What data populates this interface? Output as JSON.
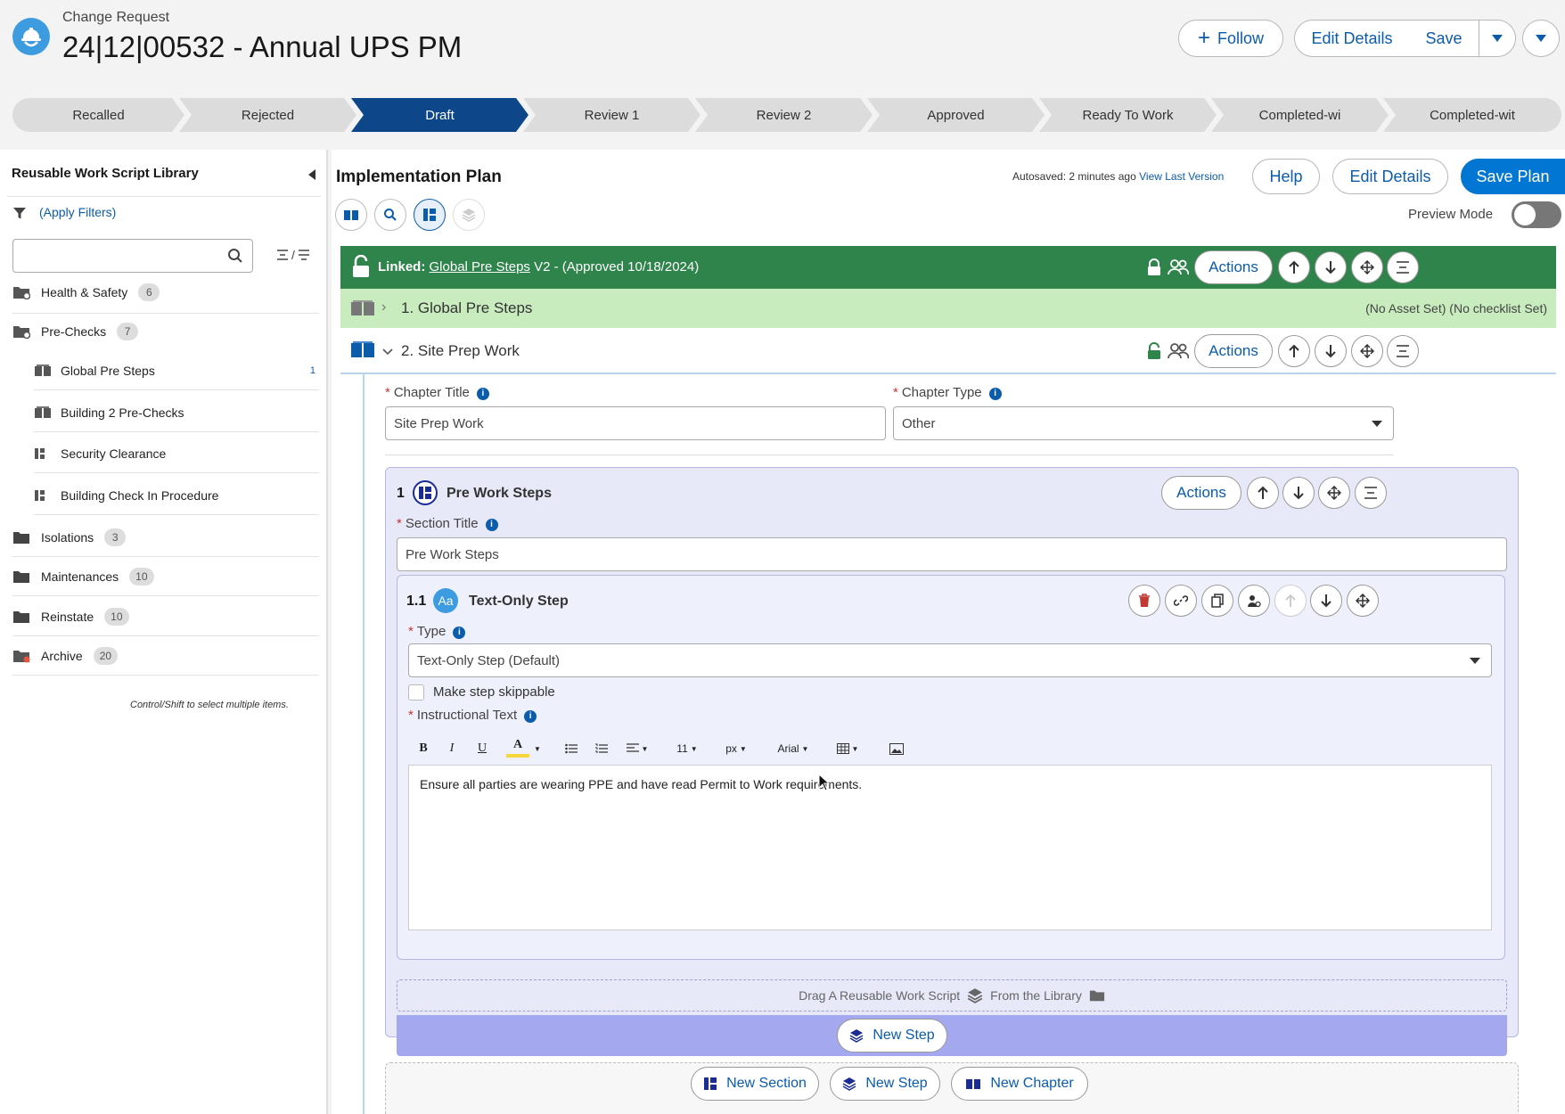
{
  "header": {
    "record_type": "Change Request",
    "title": "24|12|00532 - Annual UPS PM",
    "follow_label": "Follow",
    "edit_details_label": "Edit Details",
    "save_label": "Save"
  },
  "path": {
    "active": "Draft",
    "stages": [
      "Recalled",
      "Rejected",
      "Draft",
      "Review 1",
      "Review 2",
      "Approved",
      "Ready To Work",
      "Completed-wi",
      "Completed-wit"
    ]
  },
  "library": {
    "title": "Reusable Work Script Library",
    "filter_label": "(Apply Filters)",
    "search_placeholder": "",
    "expand_collapse": "/",
    "folders": [
      {
        "label": "Health & Safety",
        "count": "6"
      },
      {
        "label": "Pre-Checks",
        "count": "7"
      },
      {
        "label": "Isolations",
        "count": "3"
      },
      {
        "label": "Maintenances",
        "count": "10"
      },
      {
        "label": "Reinstate",
        "count": "10"
      },
      {
        "label": "Archive",
        "count": "20"
      }
    ],
    "precheck_items": [
      {
        "label": "Global Pre Steps",
        "count": "1"
      },
      {
        "label": "Building 2 Pre-Checks",
        "count": ""
      },
      {
        "label": "Security Clearance",
        "count": ""
      },
      {
        "label": "Building Check In Procedure",
        "count": ""
      }
    ],
    "note": "Control/Shift to select multiple items."
  },
  "plan": {
    "title": "Implementation Plan",
    "autosaved": "Autosaved: 2 minutes ago",
    "view_last_version": "View Last Version",
    "help_label": "Help",
    "edit_details_label": "Edit Details",
    "save_plan_label": "Save Plan",
    "preview_mode_label": "Preview Mode",
    "actions_label": "Actions",
    "linked": {
      "prefix": "Linked:",
      "name": "Global Pre Steps",
      "suffix": "V2 - (Approved 10/18/2024)"
    },
    "chapter1": {
      "title": "1. Global Pre Steps",
      "asset": "(No Asset Set)",
      "checklist": "(No checklist Set)"
    },
    "chapter2": {
      "title": "2. Site Prep Work",
      "chapter_title_label": "Chapter Title",
      "chapter_title_value": "Site Prep Work",
      "chapter_type_label": "Chapter Type",
      "chapter_type_value": "Other"
    },
    "section": {
      "number": "1",
      "name": "Pre Work Steps",
      "title_label": "Section Title",
      "title_value": "Pre Work Steps"
    },
    "step": {
      "number": "1.1",
      "name": "Text-Only Step",
      "type_label": "Type",
      "type_value": "Text-Only Step (Default)",
      "skippable_label": "Make step skippable",
      "instructional_label": "Instructional Text",
      "instructional_text": "Ensure all parties are wearing PPE and have read Permit to Work requirements."
    },
    "editor": {
      "bold": "B",
      "italic": "I",
      "underline": "U",
      "color": "A",
      "font_size": "11",
      "unit": "px",
      "font": "Arial"
    },
    "drag_prefix": "Drag A Reusable Work Script",
    "drag_suffix": "From the Library",
    "new_step_label": "New Step",
    "new_section_label": "New Section",
    "new_chapter_label": "New Chapter"
  },
  "colors": {
    "brand": "#0b5cab",
    "active_stage": "#0d4789",
    "linked_bar": "#2e844a",
    "prebar": "#c8ecbe",
    "section_bg": "#e7e8f8"
  }
}
